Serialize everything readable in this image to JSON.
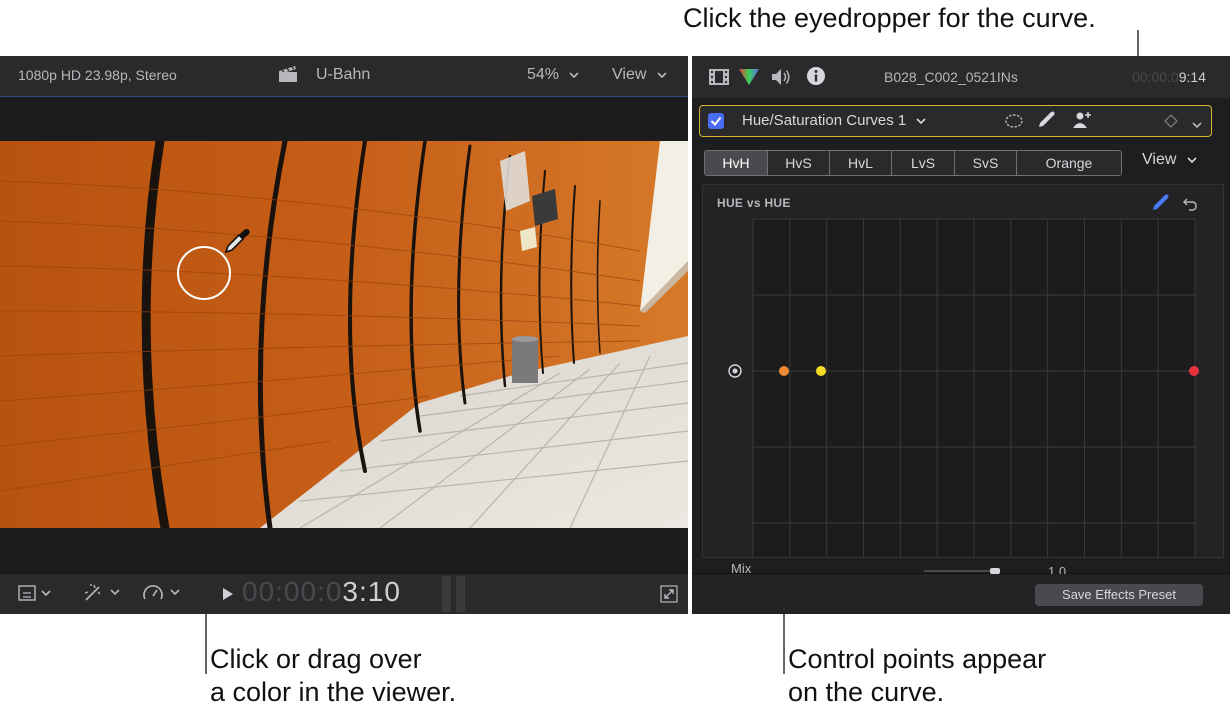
{
  "callouts": {
    "top_right": "Click the eyedropper for the curve.",
    "bottom_left_line1": "Click or drag over",
    "bottom_left_line2": "a color in the viewer.",
    "bottom_right_line1": "Control points appear",
    "bottom_right_line2": "on the curve."
  },
  "viewer": {
    "format": "1080p HD 23.98p, Stereo",
    "clip_name": "U-Bahn",
    "zoom": "54%",
    "view_label": "View",
    "timecode_dim": "00:00:0",
    "timecode_bright": "3:10",
    "icons": [
      "clapper-icon",
      "chevron-down-icon",
      "play-icon",
      "fullscreen-icon",
      "transform-icon",
      "magic-wand-icon",
      "speed-icon"
    ]
  },
  "inspector": {
    "clip_name": "B028_C002_0521INs",
    "timecode_dim": "00:00:0",
    "timecode_bright": "9:14",
    "effect_name": "Hue/Saturation Curves 1",
    "effect_enabled": true,
    "tabs": [
      "HvH",
      "HvS",
      "HvL",
      "LvS",
      "SvS",
      "Orange"
    ],
    "selected_tab": "HvH",
    "view_label": "View",
    "curve_title": "HUE vs HUE",
    "mix_label": "Mix",
    "mix_value": "1.0",
    "save_button": "Save Effects Preset",
    "accent_color": "#d8b52a",
    "checkbox_color": "#4a6cf0"
  },
  "curve": {
    "control_points": [
      {
        "color": "#f08a30"
      },
      {
        "color": "#f5dc20"
      },
      {
        "color": "#e8323c"
      }
    ]
  }
}
